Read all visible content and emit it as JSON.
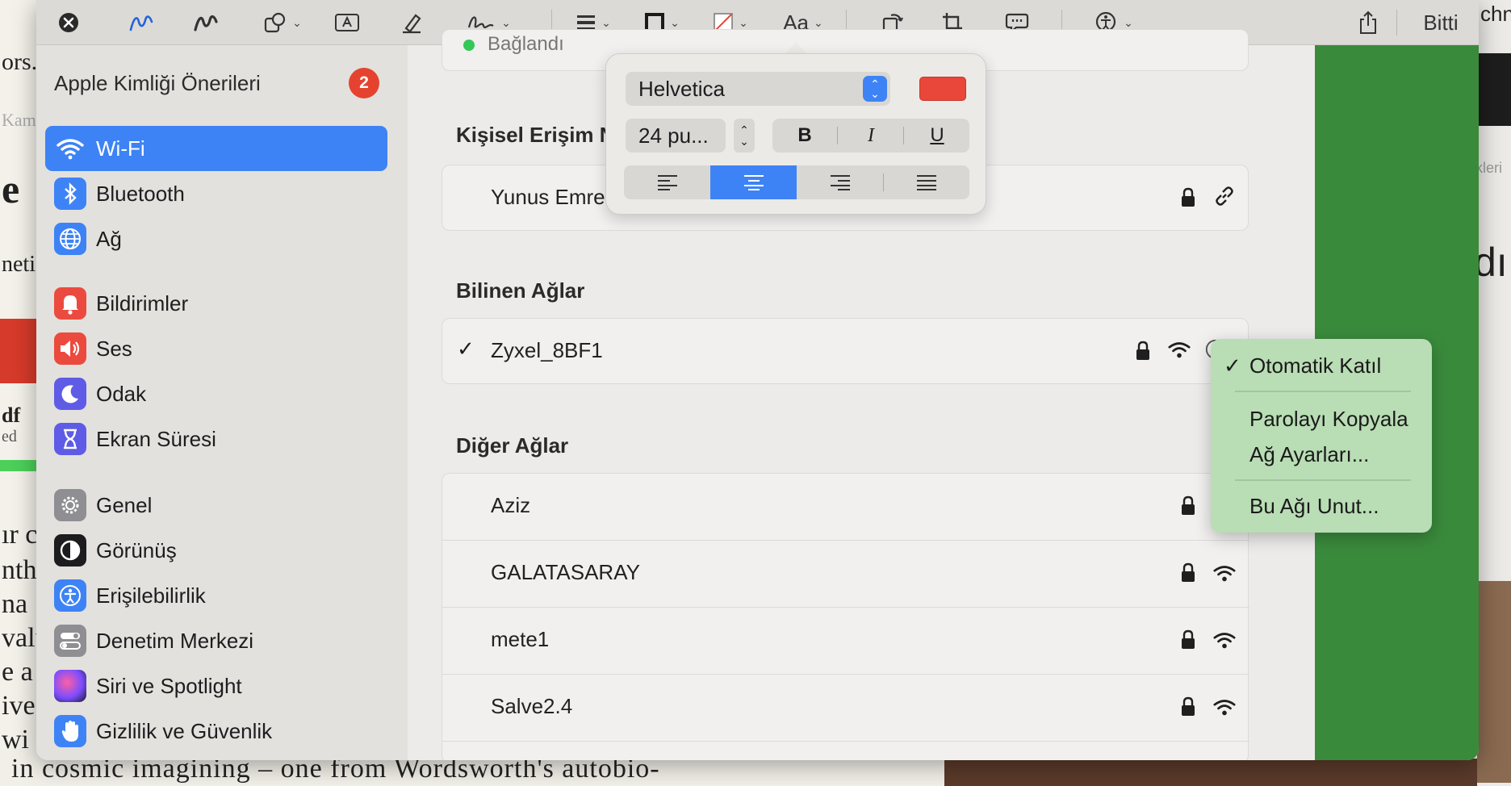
{
  "toolbar": {
    "font_button_label": "Aa",
    "done_label": "Bitti"
  },
  "background": {
    "left_fragments": [
      "ors.",
      "Kam",
      "e",
      "neti",
      "df",
      "ed",
      "ır c",
      "nth",
      "na",
      "valu",
      "e a",
      "ive",
      "wi"
    ],
    "bottom_text": "in cosmic imagining – one from Wordsworth's autobio-",
    "right_fragments": [
      "chn",
      "ikleri",
      "dı,"
    ]
  },
  "sidebar": {
    "title": "Apple Kimliği Önerileri",
    "badge": "2",
    "items": [
      {
        "label": "Wi-Fi",
        "icon": "wifi-icon",
        "color": "#3e83f5",
        "selected": true
      },
      {
        "label": "Bluetooth",
        "icon": "bluetooth-icon",
        "color": "#3e83f5"
      },
      {
        "label": "Ağ",
        "icon": "globe-icon",
        "color": "#3e83f5"
      },
      {
        "label": "Bildirimler",
        "icon": "bell-icon",
        "color": "#eb4b3e"
      },
      {
        "label": "Ses",
        "icon": "speaker-icon",
        "color": "#eb4b3e"
      },
      {
        "label": "Odak",
        "icon": "moon-icon",
        "color": "#5e5ce6"
      },
      {
        "label": "Ekran Süresi",
        "icon": "hourglass-icon",
        "color": "#5e5ce6"
      },
      {
        "label": "Genel",
        "icon": "gear-icon",
        "color": "#8e8e93"
      },
      {
        "label": "Görünüş",
        "icon": "appearance-icon",
        "color": "#1c1c1e"
      },
      {
        "label": "Erişilebilirlik",
        "icon": "accessibility-icon",
        "color": "#3e83f5"
      },
      {
        "label": "Denetim Merkezi",
        "icon": "control-center-icon",
        "color": "#8e8e93"
      },
      {
        "label": "Siri ve Spotlight",
        "icon": "siri-icon",
        "color": "#5e5ce6"
      },
      {
        "label": "Gizlilik ve Güvenlik",
        "icon": "hand-icon",
        "color": "#3e83f5"
      }
    ]
  },
  "content": {
    "top_status": "Bağlandı",
    "personal_hotspot_title": "Kişisel Erişim N",
    "hotspot_name": "Yunus Emre",
    "known_title": "Bilinen Ağlar",
    "known_network": "Zyxel_8BF1",
    "other_title": "Diğer Ağlar",
    "other_networks": [
      "Aziz",
      "GALATASARAY",
      "mete1",
      "Salve2.4"
    ]
  },
  "popover": {
    "font_name": "Helvetica",
    "font_size": "24 pu...",
    "bold": "B",
    "italic": "I",
    "underline": "U",
    "color": "#e8473a",
    "alignment": "center"
  },
  "menu": {
    "items": [
      "Otomatik Katıl",
      "Parolayı Kopyala",
      "Ağ Ayarları...",
      "Bu Ağı Unut..."
    ],
    "checked": "Otomatik Katıl",
    "checkmark": "✓"
  },
  "colors": {
    "accent": "#3e83f5",
    "badge": "#e5432f",
    "green_panel": "#3a8a3c"
  }
}
